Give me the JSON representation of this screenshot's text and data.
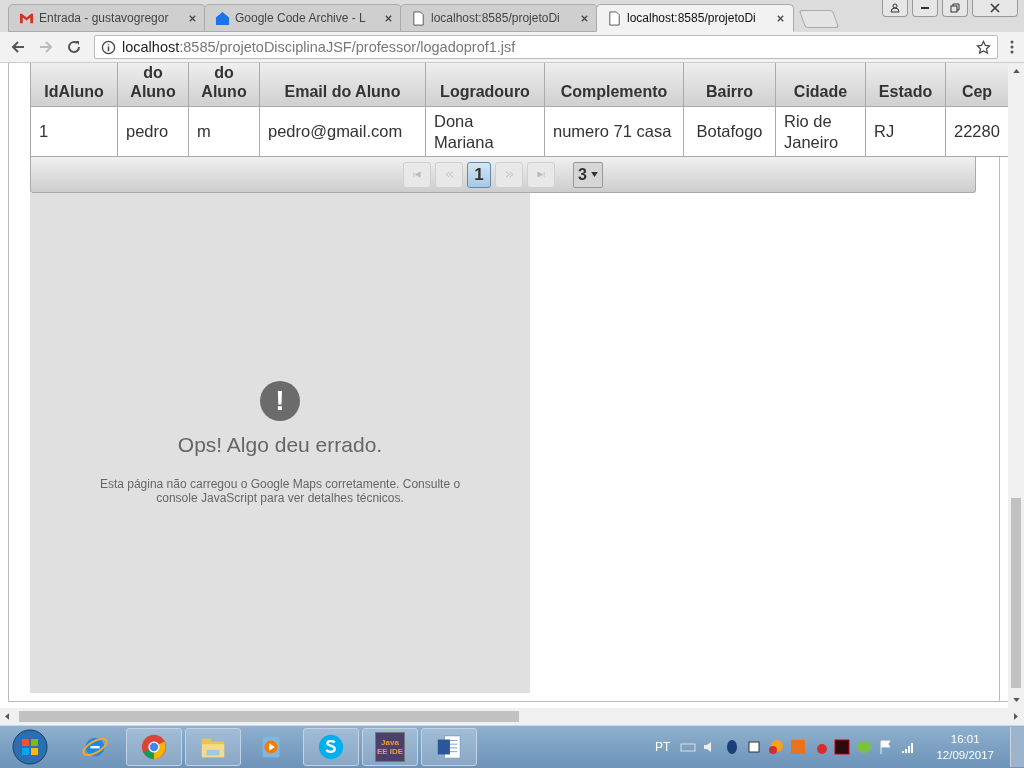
{
  "browser": {
    "tabs": [
      {
        "title": "Entrada - gustavogregor",
        "selected": false
      },
      {
        "title": "Google Code Archive - L",
        "selected": false
      },
      {
        "title": "localhost:8585/projetoDi",
        "selected": false
      },
      {
        "title": "localhost:8585/projetoDi",
        "selected": true
      }
    ],
    "address": {
      "host": "localhost",
      "path": ":8585/projetoDisciplinaJSF/professor/logadoprof1.jsf"
    }
  },
  "table": {
    "columns": [
      "IdAluno",
      "do Aluno",
      "do Aluno",
      "Email do Aluno",
      "Logradouro",
      "Complemento",
      "Bairro",
      "Cidade",
      "Estado",
      "Cep"
    ],
    "rows": [
      [
        "1",
        "pedro",
        "m",
        "pedro@gmail.com",
        "Dona Mariana",
        "numero 71 casa",
        "Botafogo",
        "Rio de Janeiro",
        "RJ",
        "22280"
      ]
    ],
    "paginator": {
      "pages": [
        {
          "label": "1",
          "selected": true
        }
      ],
      "rows_per_page": "3"
    }
  },
  "map_error": {
    "icon": "!",
    "title": "Ops! Algo deu errado.",
    "message": "Esta página não carregou o Google Maps corretamente. Consulte o console JavaScript para ver detalhes técnicos."
  },
  "taskbar": {
    "apps": [
      {
        "kind": "ie",
        "pinned_open": false
      },
      {
        "kind": "chrome",
        "pinned_open": true
      },
      {
        "kind": "folder",
        "pinned_open": true
      },
      {
        "kind": "media",
        "pinned_open": false
      },
      {
        "kind": "skype",
        "pinned_open": true
      },
      {
        "kind": "ide",
        "pinned_open": true,
        "label": "Java EE IDE"
      },
      {
        "kind": "word",
        "pinned_open": true
      }
    ],
    "language": "PT",
    "time": "16:01",
    "date": "12/09/2017"
  }
}
